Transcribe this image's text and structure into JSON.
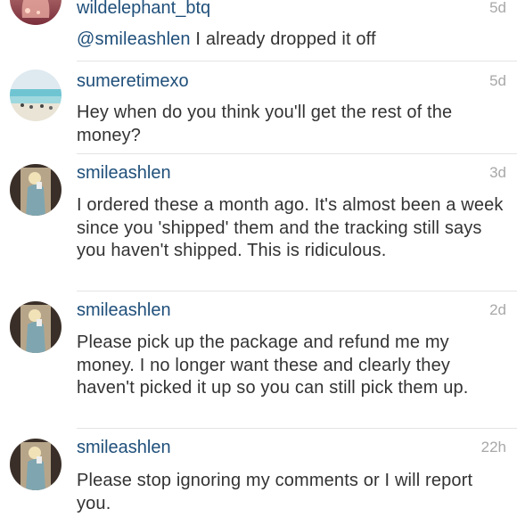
{
  "comments": [
    {
      "username": "wildelephant_btq",
      "time": "5d",
      "mention": "@smileashlen",
      "text": " I already dropped it off",
      "avatar_icon": "bottle-icon"
    },
    {
      "username": "sumeretimexo",
      "time": "5d",
      "text": "Hey when do you think you'll get the rest of the money?",
      "avatar_icon": "beach-icon"
    },
    {
      "username": "smileashlen",
      "time": "3d",
      "text": "I ordered these a month ago. It's almost been a week since you 'shipped' them and the tracking still says you haven't shipped. This is ridiculous.",
      "avatar_icon": "mirror-selfie-icon"
    },
    {
      "username": "smileashlen",
      "time": "2d",
      "text": "Please pick up the package and refund me my money. I no longer want these and clearly they haven't picked it up so you can still pick them up.",
      "avatar_icon": "mirror-selfie-icon"
    },
    {
      "username": "smileashlen",
      "time": "22h",
      "text": "Please stop ignoring my comments or I will report you.",
      "avatar_icon": "mirror-selfie-icon"
    }
  ]
}
